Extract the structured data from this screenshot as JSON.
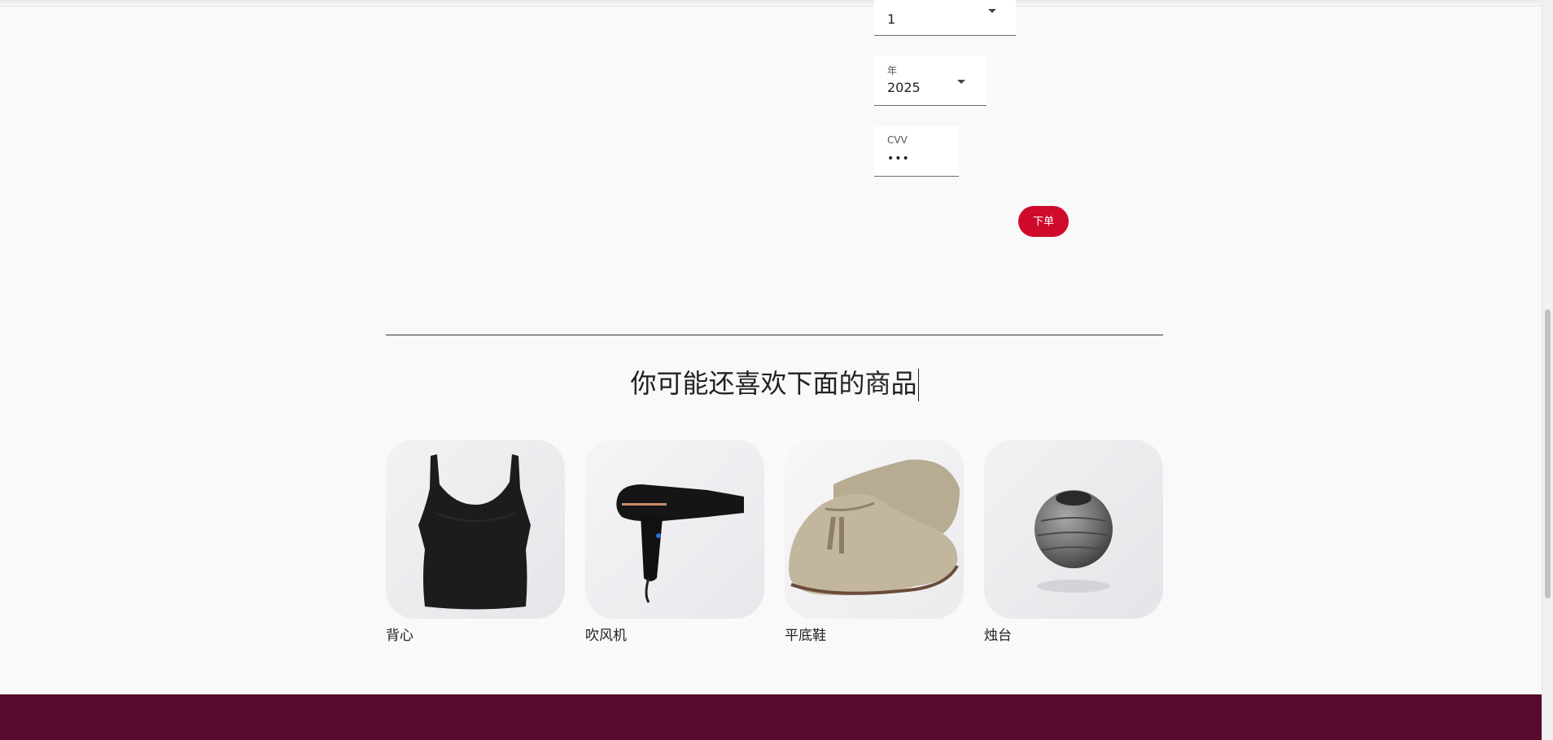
{
  "checkout": {
    "month": {
      "value": "1"
    },
    "year": {
      "label": "年",
      "value": "2025"
    },
    "cvv": {
      "label": "CVV",
      "value": "•••"
    },
    "order_button": "下单"
  },
  "recommendations": {
    "title": "你可能还喜欢下面的商品",
    "products": [
      {
        "name": "背心",
        "icon": "tank-top-image"
      },
      {
        "name": "吹风机",
        "icon": "hair-dryer-image"
      },
      {
        "name": "平底鞋",
        "icon": "loafer-shoes-image"
      },
      {
        "name": "烛台",
        "icon": "candle-holder-image"
      }
    ]
  },
  "colors": {
    "accent": "#d00a2c",
    "footer": "#570b2d",
    "background": "#f9f9f9"
  }
}
